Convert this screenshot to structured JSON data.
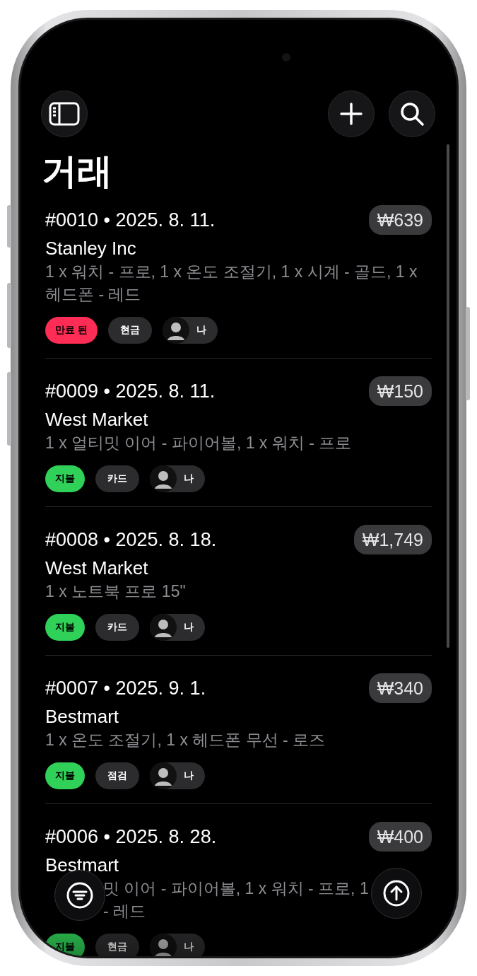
{
  "title": "거래",
  "transactions": [
    {
      "heading": "#0010 • 2025. 8. 11.",
      "amount": "₩639",
      "vendor": "Stanley Inc",
      "items": "1 x 워치 - 프로, 1 x 온도 조절기, 1 x 시계 - 골드, 1 x 헤드폰 - 레드",
      "status": {
        "label": "만료 된",
        "kind": "expired"
      },
      "payment": "현금",
      "owner": "나"
    },
    {
      "heading": "#0009 • 2025. 8. 11.",
      "amount": "₩150",
      "vendor": "West Market",
      "items": "1 x 얼티밋 이어 - 파이어볼, 1 x 워치 - 프로",
      "status": {
        "label": "지불",
        "kind": "paid"
      },
      "payment": "카드",
      "owner": "나"
    },
    {
      "heading": "#0008 • 2025. 8. 18.",
      "amount": "₩1,749",
      "vendor": "West Market",
      "items": "1 x 노트북 프로 15\"",
      "status": {
        "label": "지불",
        "kind": "paid"
      },
      "payment": "카드",
      "owner": "나"
    },
    {
      "heading": "#0007 • 2025. 9. 1.",
      "amount": "₩340",
      "vendor": "Bestmart",
      "items": "1 x 온도 조절기, 1 x 헤드폰 무선 - 로즈",
      "status": {
        "label": "지불",
        "kind": "paid"
      },
      "payment": "점검",
      "owner": "나"
    },
    {
      "heading": "#0006 • 2025. 8. 28.",
      "amount": "₩400",
      "vendor": "Bestmart",
      "covered_lines": [
        {
          "text": "밋 이어 - 파이어볼, 1 x 워치 - 프로, 1",
          "after_button": true
        },
        {
          "text": "- 레드",
          "after_button": true
        }
      ],
      "status": {
        "label": "지불",
        "kind": "paid"
      },
      "payment": "현금",
      "owner": "나"
    }
  ]
}
